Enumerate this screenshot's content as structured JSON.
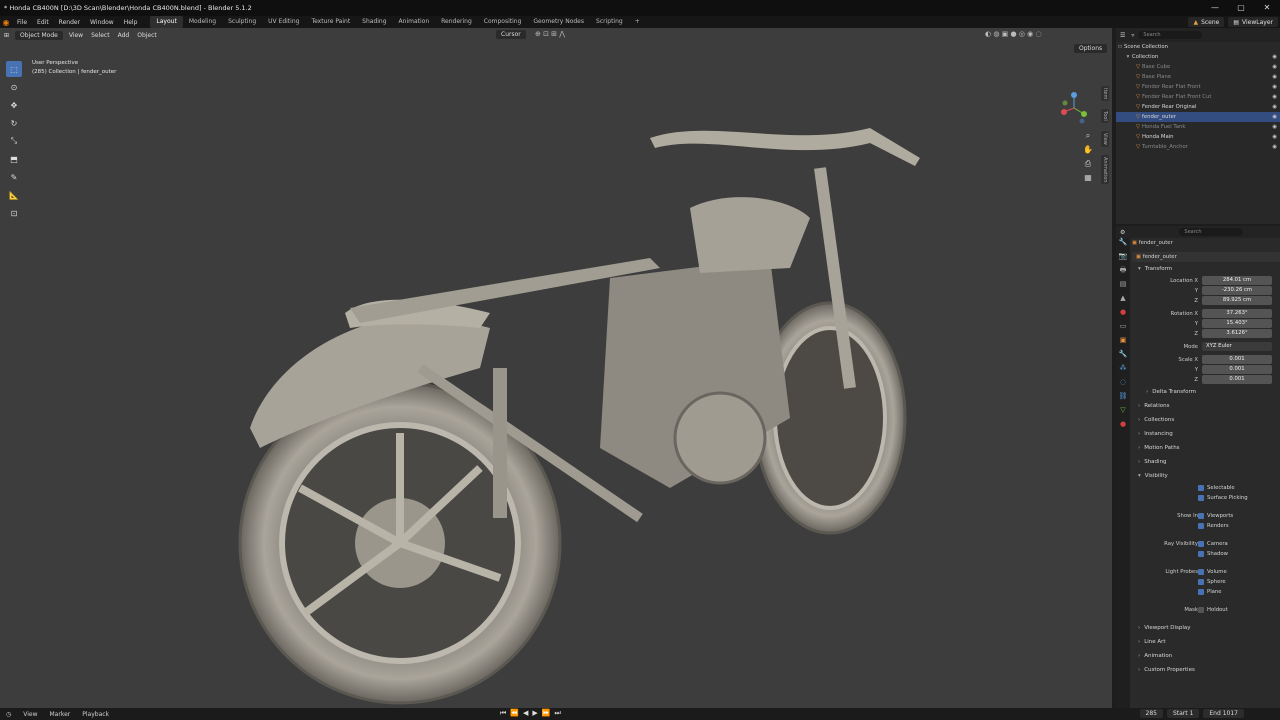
{
  "window": {
    "title": "* Honda CB400N [D:\\3D Scan\\Blender\\Honda CB400N.blend] - Blender 5.1.2",
    "controls": [
      "—",
      "▢",
      "✕"
    ]
  },
  "menubar": {
    "menus": [
      "File",
      "Edit",
      "Render",
      "Window",
      "Help"
    ],
    "workspaces": [
      "Layout",
      "Modeling",
      "Sculpting",
      "UV Editing",
      "Texture Paint",
      "Shading",
      "Animation",
      "Rendering",
      "Compositing",
      "Geometry Nodes",
      "Scripting"
    ],
    "active_workspace": "Layout",
    "scene": "Scene",
    "view_layer": "ViewLayer"
  },
  "viewport": {
    "mode": "Object Mode",
    "menus": [
      "View",
      "Select",
      "Add",
      "Object"
    ],
    "pivot": "Cursor",
    "options": "Options",
    "overlay_line1": "User Perspective",
    "overlay_line2": "(285) Collection | fender_outer",
    "sidebar_tabs": [
      "Item",
      "Tool",
      "View",
      "Animation"
    ]
  },
  "outliner": {
    "search_placeholder": "Search",
    "root": "Scene Collection",
    "collection": "Collection",
    "items": [
      {
        "name": "Base Cube",
        "dim": true
      },
      {
        "name": "Base Plane",
        "dim": true
      },
      {
        "name": "Fender Rear Flat Front",
        "dim": true
      },
      {
        "name": "Fender Rear Flat Front Cut",
        "dim": true
      },
      {
        "name": "Fender Rear Original",
        "dim": false
      },
      {
        "name": "fender_outer",
        "dim": false,
        "selected": true
      },
      {
        "name": "Honda Fuel Tank",
        "dim": true
      },
      {
        "name": "Honda Main",
        "dim": false
      },
      {
        "name": "Turntable_Anchor",
        "dim": true
      }
    ]
  },
  "properties": {
    "search_placeholder": "Search",
    "breadcrumb": "fender_outer",
    "object_name": "fender_outer",
    "transform_label": "Transform",
    "location_label": "Location X",
    "location": [
      "284.01 cm",
      "-230.26 cm",
      "89.925 cm"
    ],
    "rotation_label": "Rotation X",
    "rotation": [
      "37.263°",
      "15.403°",
      "3.6126°"
    ],
    "mode_label": "Mode",
    "mode_value": "XYZ Euler",
    "scale_label": "Scale X",
    "scale": [
      "0.001",
      "0.001",
      "0.001"
    ],
    "axis_y": "Y",
    "axis_z": "Z",
    "panels_a": [
      "Delta Transform"
    ],
    "panels_b": [
      "Relations",
      "Collections",
      "Instancing",
      "Motion Paths",
      "Shading"
    ],
    "visibility": "Visibility",
    "selectable": "Selectable",
    "surface_picking": "Surface Picking",
    "show_in": "Show In",
    "viewports": "Viewports",
    "renders": "Renders",
    "ray_visibility": "Ray Visibility",
    "camera": "Camera",
    "shadow": "Shadow",
    "light_probes": "Light Probes",
    "volume": "Volume",
    "sphere": "Sphere",
    "plane": "Plane",
    "mask": "Mask",
    "holdout": "Holdout",
    "panels_c": [
      "Viewport Display",
      "Line Art",
      "Animation",
      "Custom Properties"
    ]
  },
  "timeline": {
    "menus": [
      "View",
      "Marker",
      "Playback"
    ],
    "current_frame": "285",
    "start_label": "Start",
    "start": "1",
    "end_label": "End",
    "end": "1017"
  },
  "colors": {
    "accent": "#4772b3",
    "selection": "#334d80",
    "object_icon": "#e89240",
    "viewport_bg": "#3d3d3d"
  }
}
